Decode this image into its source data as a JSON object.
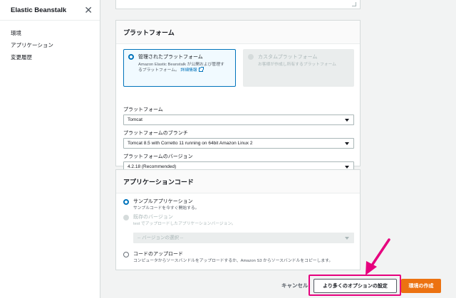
{
  "sidebar": {
    "title": "Elastic Beanstalk",
    "items": [
      {
        "label": "環境"
      },
      {
        "label": "アプリケーション"
      },
      {
        "label": "変更履歴"
      }
    ]
  },
  "platform_section": {
    "heading": "プラットフォーム",
    "managed": {
      "title": "管理されたプラットフォーム",
      "desc_line1": "Amazon Elastic Beanstalk が公開および管理す",
      "desc_line2": "るプラットフォーム。",
      "link": "詳細情報",
      "selected": true
    },
    "custom": {
      "title": "カスタムプラットフォーム",
      "desc": "お客様が作成し所有するプラットフォーム",
      "selected": false
    },
    "platform_label": "プラットフォーム",
    "platform_value": "Tomcat",
    "branch_label": "プラットフォームのブランチ",
    "branch_value": "Tomcat 8.5 with Corretto 11 running on 64bit Amazon Linux 2",
    "version_label": "プラットフォームのバージョン",
    "version_value": "4.2.18 (Recommended)"
  },
  "app_code_section": {
    "heading": "アプリケーションコード",
    "sample": {
      "title": "サンプルアプリケーション",
      "desc": "サンプルコードを今すぐ開始する。",
      "selected": true
    },
    "existing": {
      "title": "既存のバージョン",
      "desc": "test でアップロードしたアプリケーションバージョン。",
      "select_placeholder": "-- バージョンの選択 --",
      "selected": false
    },
    "upload": {
      "title": "コードのアップロード",
      "desc": "コンピュータからソースバンドルをアップロードするか、Amazon S3 からソースバンドルをコピーします。",
      "selected": false
    }
  },
  "footer": {
    "cancel_label": "キャンセル",
    "more_options_label": "より多くのオプションの設定",
    "create_label": "環境の作成"
  },
  "colors": {
    "accent": "#0073bb",
    "primary_button": "#ec7211",
    "annotation": "#e6007e"
  }
}
